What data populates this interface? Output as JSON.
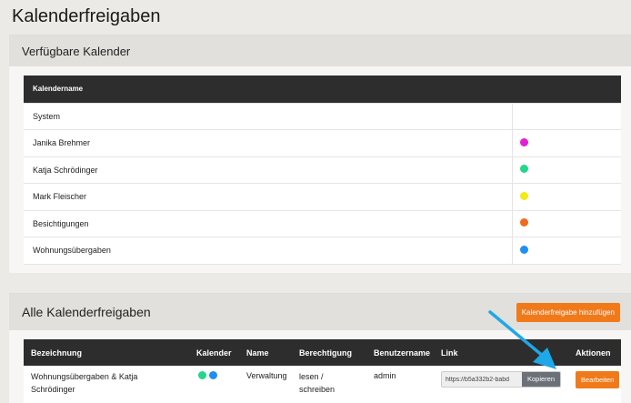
{
  "page": {
    "title": "Kalenderfreigaben"
  },
  "calendars_panel": {
    "title": "Verfügbare Kalender",
    "column_header": "Kalendername",
    "rows": [
      {
        "name": "System",
        "color": ""
      },
      {
        "name": "Janika Brehmer",
        "color": "#e01fd8"
      },
      {
        "name": "Katja Schrödinger",
        "color": "#22d68a"
      },
      {
        "name": "Mark Fleischer",
        "color": "#f2ea13"
      },
      {
        "name": "Besichtigungen",
        "color": "#f06a1e"
      },
      {
        "name": "Wohnungsübergaben",
        "color": "#1f8ff2"
      }
    ]
  },
  "shares_panel": {
    "title": "Alle Kalenderfreigaben",
    "add_button": "Kalenderfreigabe hinzufügen",
    "headers": {
      "bezeichnung": "Bezeichnung",
      "kalender": "Kalender",
      "name": "Name",
      "berechtigung": "Berechtigung",
      "benutzername": "Benutzername",
      "link": "Link",
      "aktionen": "Aktionen"
    },
    "rows": [
      {
        "bezeichnung": "Wohnungsübergaben & Katja Schrödinger",
        "calendar_colors": [
          "#22d68a",
          "#1f8ff2"
        ],
        "name": "Verwaltung",
        "berechtigung": "lesen / schreiben",
        "benutzername": "admin",
        "link": "https://b5a332b2-babd",
        "copy_label": "Kopieren",
        "edit_label": "Bearbeiten"
      }
    ]
  },
  "colors": {
    "accent": "#f07a1a",
    "header_bg": "#2d2d2d",
    "arrow": "#1fa8e8"
  }
}
